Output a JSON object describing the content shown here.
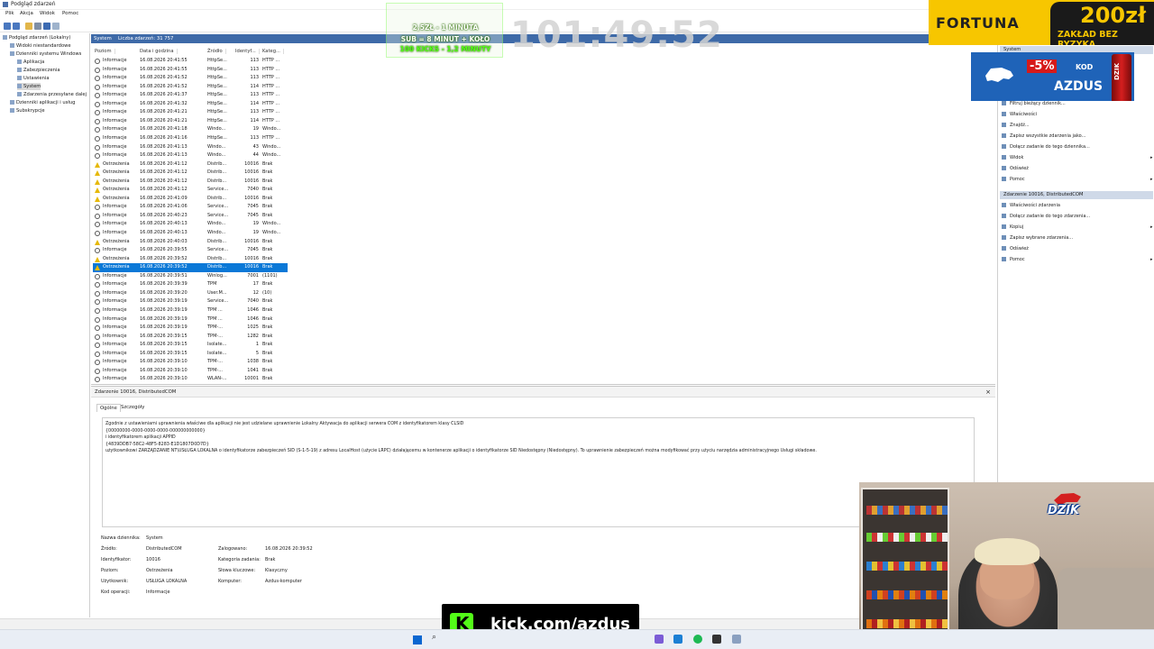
{
  "window": {
    "title": "Podgląd zdarzeń"
  },
  "menu": [
    "Plik",
    "Akcja",
    "Widok",
    "Pomoc"
  ],
  "tree": [
    {
      "label": "Podgląd zdarzeń (Lokalny)",
      "indent": 0
    },
    {
      "label": "Widoki niestandardowe",
      "indent": 1
    },
    {
      "label": "Dzienniki systemu Windows",
      "indent": 1
    },
    {
      "label": "Aplikacja",
      "indent": 2
    },
    {
      "label": "Zabezpieczenia",
      "indent": 2
    },
    {
      "label": "Ustawienia",
      "indent": 2
    },
    {
      "label": "System",
      "indent": 2,
      "selected": true
    },
    {
      "label": "Zdarzenia przesyłane dalej",
      "indent": 2
    },
    {
      "label": "Dzienniki aplikacji i usług",
      "indent": 1
    },
    {
      "label": "Subskrypcje",
      "indent": 1
    }
  ],
  "log": {
    "name": "System",
    "count_label": "Liczba zdarzeń: 31 757"
  },
  "columns": [
    "Poziom",
    "Data i godzina",
    "Źródło",
    "Identyf...",
    "Kateg..."
  ],
  "events": [
    {
      "level": "Informacje",
      "date": "16.08.2026 20:41:55",
      "source": "HttpSe...",
      "id": "113",
      "cat": "HTTP ..."
    },
    {
      "level": "Informacje",
      "date": "16.08.2026 20:41:55",
      "source": "HttpSe...",
      "id": "113",
      "cat": "HTTP ..."
    },
    {
      "level": "Informacje",
      "date": "16.08.2026 20:41:52",
      "source": "HttpSe...",
      "id": "113",
      "cat": "HTTP ..."
    },
    {
      "level": "Informacje",
      "date": "16.08.2026 20:41:52",
      "source": "HttpSe...",
      "id": "114",
      "cat": "HTTP ..."
    },
    {
      "level": "Informacje",
      "date": "16.08.2026 20:41:37",
      "source": "HttpSe...",
      "id": "113",
      "cat": "HTTP ..."
    },
    {
      "level": "Informacje",
      "date": "16.08.2026 20:41:32",
      "source": "HttpSe...",
      "id": "114",
      "cat": "HTTP ..."
    },
    {
      "level": "Informacje",
      "date": "16.08.2026 20:41:21",
      "source": "HttpSe...",
      "id": "113",
      "cat": "HTTP ..."
    },
    {
      "level": "Informacje",
      "date": "16.08.2026 20:41:21",
      "source": "HttpSe...",
      "id": "114",
      "cat": "HTTP ..."
    },
    {
      "level": "Informacje",
      "date": "16.08.2026 20:41:18",
      "source": "Windo...",
      "id": "19",
      "cat": "Windo..."
    },
    {
      "level": "Informacje",
      "date": "16.08.2026 20:41:16",
      "source": "HttpSe...",
      "id": "113",
      "cat": "HTTP ..."
    },
    {
      "level": "Informacje",
      "date": "16.08.2026 20:41:13",
      "source": "Windo...",
      "id": "43",
      "cat": "Windo..."
    },
    {
      "level": "Informacje",
      "date": "16.08.2026 20:41:13",
      "source": "Windo...",
      "id": "44",
      "cat": "Windo..."
    },
    {
      "level": "Ostrzeżenia",
      "date": "16.08.2026 20:41:12",
      "source": "Distrib...",
      "id": "10016",
      "cat": "Brak"
    },
    {
      "level": "Ostrzeżenia",
      "date": "16.08.2026 20:41:12",
      "source": "Distrib...",
      "id": "10016",
      "cat": "Brak"
    },
    {
      "level": "Ostrzeżenia",
      "date": "16.08.2026 20:41:12",
      "source": "Distrib...",
      "id": "10016",
      "cat": "Brak"
    },
    {
      "level": "Ostrzeżenia",
      "date": "16.08.2026 20:41:12",
      "source": "Service...",
      "id": "7040",
      "cat": "Brak"
    },
    {
      "level": "Ostrzeżenia",
      "date": "16.08.2026 20:41:09",
      "source": "Distrib...",
      "id": "10016",
      "cat": "Brak"
    },
    {
      "level": "Informacje",
      "date": "16.08.2026 20:41:06",
      "source": "Service...",
      "id": "7045",
      "cat": "Brak"
    },
    {
      "level": "Informacje",
      "date": "16.08.2026 20:40:23",
      "source": "Service...",
      "id": "7045",
      "cat": "Brak"
    },
    {
      "level": "Informacje",
      "date": "16.08.2026 20:40:13",
      "source": "Windo...",
      "id": "19",
      "cat": "Windo..."
    },
    {
      "level": "Informacje",
      "date": "16.08.2026 20:40:13",
      "source": "Windo...",
      "id": "19",
      "cat": "Windo..."
    },
    {
      "level": "Ostrzeżenia",
      "date": "16.08.2026 20:40:03",
      "source": "Distrib...",
      "id": "10016",
      "cat": "Brak"
    },
    {
      "level": "Informacje",
      "date": "16.08.2026 20:39:55",
      "source": "Service...",
      "id": "7045",
      "cat": "Brak"
    },
    {
      "level": "Ostrzeżenia",
      "date": "16.08.2026 20:39:52",
      "source": "Distrib...",
      "id": "10016",
      "cat": "Brak"
    },
    {
      "level": "Ostrzeżenia",
      "date": "16.08.2026 20:39:52",
      "source": "Distrib...",
      "id": "10016",
      "cat": "Brak",
      "selected": true
    },
    {
      "level": "Informacje",
      "date": "16.08.2026 20:39:51",
      "source": "Winlog...",
      "id": "7001",
      "cat": "(1101)"
    },
    {
      "level": "Informacje",
      "date": "16.08.2026 20:39:39",
      "source": "TPM",
      "id": "17",
      "cat": "Brak"
    },
    {
      "level": "Informacje",
      "date": "16.08.2026 20:39:20",
      "source": "User.M...",
      "id": "12",
      "cat": "(10)"
    },
    {
      "level": "Informacje",
      "date": "16.08.2026 20:39:19",
      "source": "Service...",
      "id": "7040",
      "cat": "Brak"
    },
    {
      "level": "Informacje",
      "date": "16.08.2026 20:39:19",
      "source": "TPM ...",
      "id": "1046",
      "cat": "Brak"
    },
    {
      "level": "Informacje",
      "date": "16.08.2026 20:39:19",
      "source": "TPM ...",
      "id": "1046",
      "cat": "Brak"
    },
    {
      "level": "Informacje",
      "date": "16.08.2026 20:39:19",
      "source": "TPM-...",
      "id": "1025",
      "cat": "Brak"
    },
    {
      "level": "Informacje",
      "date": "16.08.2026 20:39:15",
      "source": "TPM-...",
      "id": "1282",
      "cat": "Brak"
    },
    {
      "level": "Informacje",
      "date": "16.08.2026 20:39:15",
      "source": "Isolate...",
      "id": "1",
      "cat": "Brak"
    },
    {
      "level": "Informacje",
      "date": "16.08.2026 20:39:15",
      "source": "Isolate...",
      "id": "5",
      "cat": "Brak"
    },
    {
      "level": "Informacje",
      "date": "16.08.2026 20:39:10",
      "source": "TPM-...",
      "id": "1038",
      "cat": "Brak"
    },
    {
      "level": "Informacje",
      "date": "16.08.2026 20:39:10",
      "source": "TPM-...",
      "id": "1041",
      "cat": "Brak"
    },
    {
      "level": "Informacje",
      "date": "16.08.2026 20:39:10",
      "source": "WLAN-...",
      "id": "10001",
      "cat": "Brak"
    }
  ],
  "details": {
    "title": "Zdarzenie 10016, DistributedCOM",
    "close": "×",
    "tab_general": "Ogólne",
    "tab_details": "Szczegóły",
    "message": [
      "Zgodnie z ustawieniami uprawnienia właściwe dla aplikacji nie jest udzielane uprawnienie Lokalny Aktywacja do aplikacji serwera COM z identyfikatorem klasy CLSID",
      "{00000000-0000-0000-0000-000000000000}",
      " i identyfikatorem aplikacji APPID",
      "{4839DDB7-58C2-48F5-8283-E1D1807D0D7D}",
      " użytkownikowi ZARZĄDZANIE NT\\USŁUGA LOKALNA o identyfikatorze zabezpieczeń SID (S-1-5-19) z adresu LocalHost (użycie LRPC) działającemu w kontenerze aplikacji o identyfikatorze SID Niedostępny (Niedostępny). To uprawnienie zabezpieczeń można modyfikować przy użyciu narzędzia administracyjnego Usługi składowe."
    ],
    "fields": {
      "log_name_label": "Nazwa dziennika:",
      "log_name": "System",
      "source_label": "Źródło:",
      "source": "DistributedCOM",
      "logged_label": "Zalogowano:",
      "logged": "16.08.2026 20:39:52",
      "id_label": "Identyfikator:",
      "id": "10016",
      "task_label": "Kategoria zadania:",
      "task": "Brak",
      "level_label": "Poziom:",
      "level": "Ostrzeżenia",
      "keywords_label": "Słowa kluczowe:",
      "keywords": "Klasyczny",
      "user_label": "Użytkownik:",
      "user": "USŁUGA LOKALNA",
      "computer_label": "Komputer:",
      "computer": "Azdus-komputer",
      "opcode_label": "Kod operacji:",
      "opcode": "Informacje"
    }
  },
  "actions": {
    "header1": "System",
    "items1": [
      {
        "label": "Filtruj bieżący dziennik...",
        "arrow": false
      },
      {
        "label": "Właściwości",
        "arrow": false
      },
      {
        "label": "Znajdź...",
        "arrow": false
      },
      {
        "label": "Zapisz wszystkie zdarzenia jako...",
        "arrow": false
      },
      {
        "label": "Dołącz zadanie do tego dziennika...",
        "arrow": false
      },
      {
        "label": "Widok",
        "arrow": true
      },
      {
        "label": "Odśwież",
        "arrow": false
      },
      {
        "label": "Pomoc",
        "arrow": true
      }
    ],
    "header2": "Zdarzenie 10016, DistributedCOM",
    "items2": [
      {
        "label": "Właściwości zdarzenia",
        "arrow": false
      },
      {
        "label": "Dołącz zadanie do tego zdarzenia...",
        "arrow": false
      },
      {
        "label": "Kopiuj",
        "arrow": true
      },
      {
        "label": "Zapisz wybrane zdarzenia...",
        "arrow": false
      },
      {
        "label": "Odśwież",
        "arrow": false
      },
      {
        "label": "Pomoc",
        "arrow": true
      }
    ]
  },
  "overlays": {
    "sub_line1": "2,5ZŁ - 1 MINUTA",
    "sub_line2": "SUB = 8 MINUT + KOŁO",
    "sub_line3": "100 KICKS - 1,2 MINUTY",
    "timer": "101:49:52",
    "fortuna_brand": "FORTUNA",
    "fortuna_amount": "200zł",
    "fortuna_tagline": "ZAKŁAD BEZ RYZYKA",
    "promo_discount": "-5%",
    "promo_kod": "KOD",
    "promo_code": "AZDUS",
    "promo_can": "DZIK",
    "webcam_logo": "DZIK",
    "kick_letter": "K",
    "kick_url": "kick.com/azdus"
  },
  "colors": {
    "accent_blue": "#3e6aa8",
    "selection": "#0a78d7",
    "warning": "#e6b800",
    "kick_green": "#53fc18",
    "fortuna_yellow": "#f7c600"
  }
}
